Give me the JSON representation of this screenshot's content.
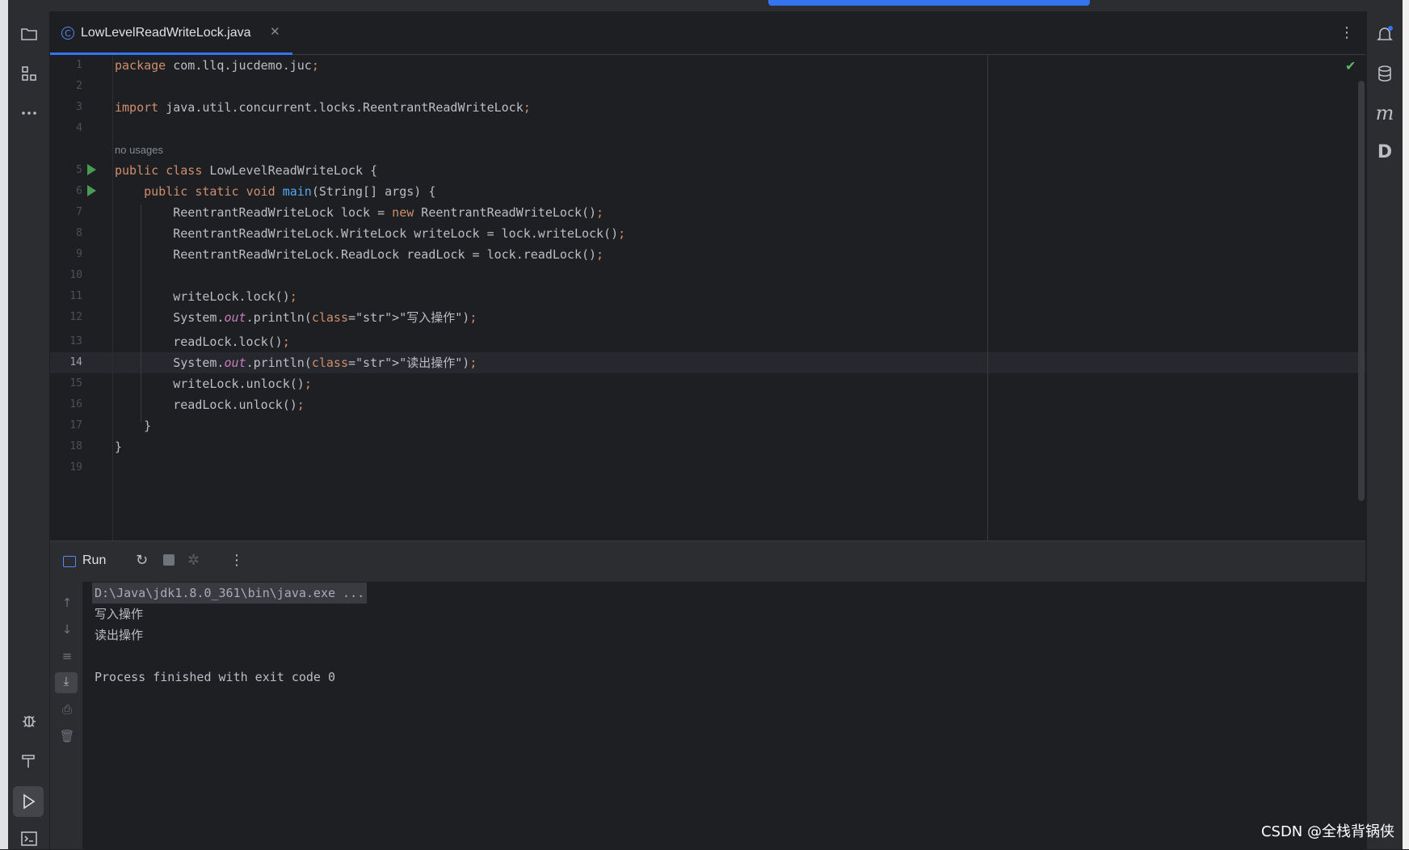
{
  "editor": {
    "tab_label": "LowLevelReadWriteLock.java",
    "tab_icon_letter": "C",
    "no_usages_hint": "no usages",
    "current_line": "14",
    "lines": [
      {
        "n": "1",
        "t": "package com.llq.jucdemo.juc;"
      },
      {
        "n": "2",
        "t": ""
      },
      {
        "n": "3",
        "t": "import java.util.concurrent.locks.ReentrantReadWriteLock;"
      },
      {
        "n": "4",
        "t": ""
      },
      {
        "n": "5",
        "t": "public class LowLevelReadWriteLock {"
      },
      {
        "n": "6",
        "t": "    public static void main(String[] args) {"
      },
      {
        "n": "7",
        "t": "        ReentrantReadWriteLock lock = new ReentrantReadWriteLock();"
      },
      {
        "n": "8",
        "t": "        ReentrantReadWriteLock.WriteLock writeLock = lock.writeLock();"
      },
      {
        "n": "9",
        "t": "        ReentrantReadWriteLock.ReadLock readLock = lock.readLock();"
      },
      {
        "n": "10",
        "t": ""
      },
      {
        "n": "11",
        "t": "        writeLock.lock();"
      },
      {
        "n": "12",
        "t": "        System.out.println(\"写入操作\");"
      },
      {
        "n": "13",
        "t": "        readLock.lock();"
      },
      {
        "n": "14",
        "t": "        System.out.println(\"读出操作\");"
      },
      {
        "n": "15",
        "t": "        writeLock.unlock();"
      },
      {
        "n": "16",
        "t": "        readLock.unlock();"
      },
      {
        "n": "17",
        "t": "    }"
      },
      {
        "n": "18",
        "t": "}"
      },
      {
        "n": "19",
        "t": ""
      }
    ]
  },
  "run_panel": {
    "title": "Run",
    "output": [
      "D:\\Java\\jdk1.8.0_361\\bin\\java.exe ...",
      "写入操作",
      "读出操作",
      "",
      "Process finished with exit code 0"
    ]
  },
  "right_toolbar": {
    "maven_label": "m",
    "d_label": "D"
  },
  "watermark": "CSDN @全栈背锅侠",
  "colors": {
    "keyword": "#cf8e6d",
    "method": "#56a8f5",
    "string": "#6aab73",
    "static_field": "#c77dbb",
    "accent": "#3574f0",
    "run_green": "#499c54"
  }
}
